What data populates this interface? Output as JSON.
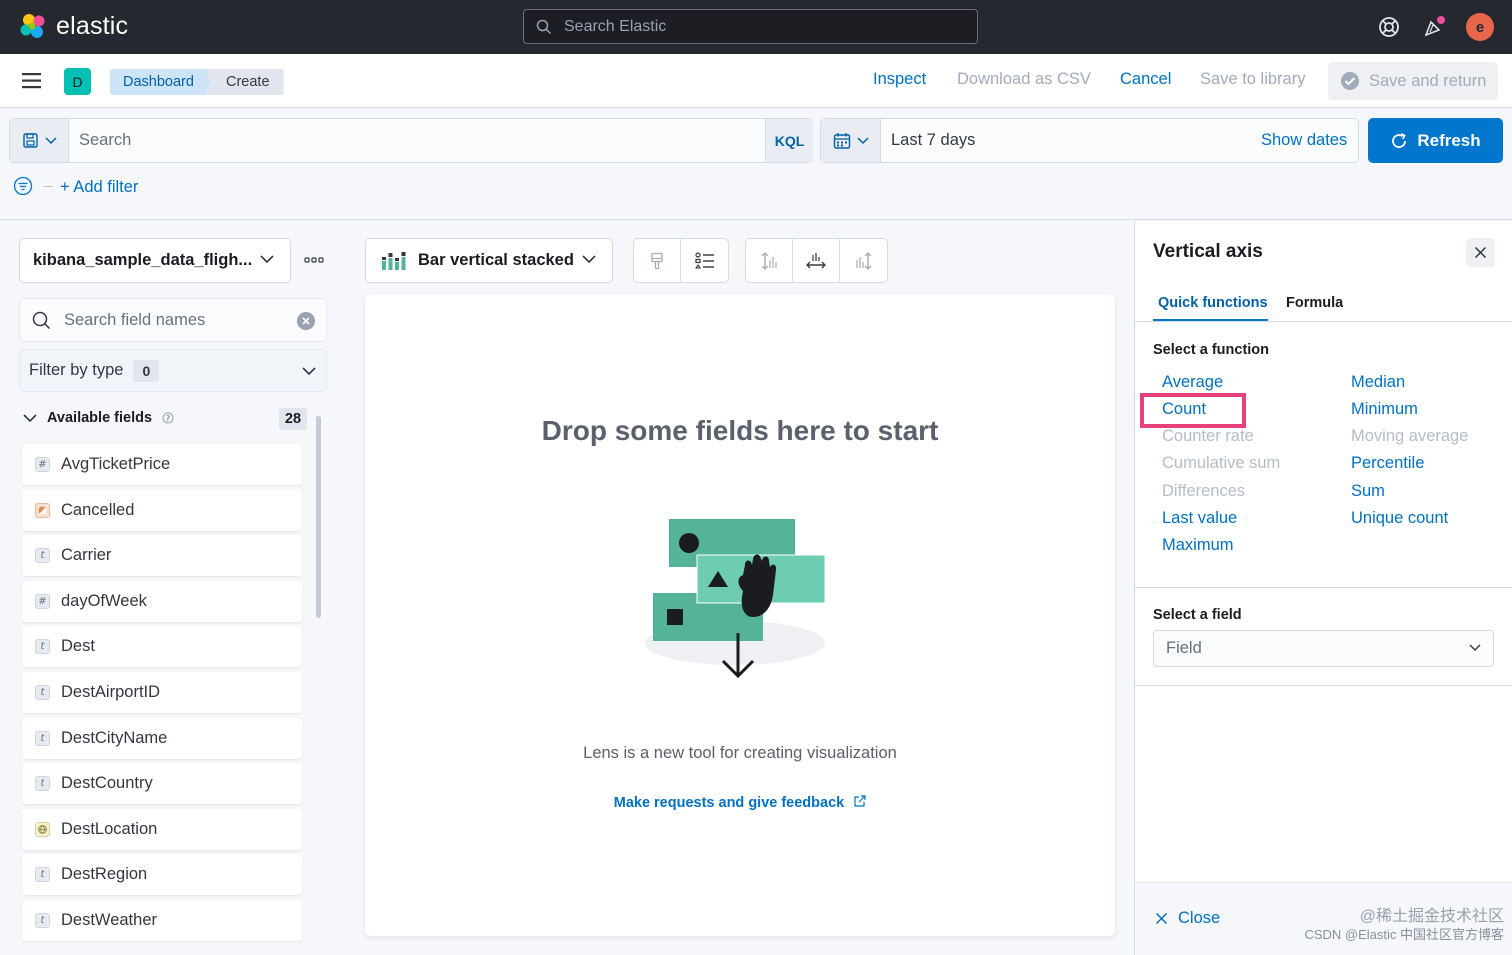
{
  "topbar": {
    "logo_text": "elastic",
    "search_placeholder": "Search Elastic",
    "user_initial": "e",
    "icons": [
      "help-icon",
      "newsfeed-icon"
    ]
  },
  "header": {
    "space_initial": "D",
    "breadcrumbs": [
      "Dashboard",
      "Create"
    ],
    "inspect": "Inspect",
    "download_csv": "Download as CSV",
    "cancel": "Cancel",
    "save_to_library": "Save to library",
    "save_and_return": "Save and return"
  },
  "query": {
    "placeholder": "Search",
    "language": "KQL",
    "date_range": "Last 7 days",
    "show_dates": "Show dates",
    "refresh": "Refresh",
    "add_filter": "+ Add filter"
  },
  "left_panel": {
    "index_pattern": "kibana_sample_data_fligh...",
    "field_search_placeholder": "Search field names",
    "filter_by_type": "Filter by type",
    "filter_count": "0",
    "available_fields_label": "Available fields",
    "available_fields_count": "28",
    "fields": [
      {
        "name": "AvgTicketPrice",
        "type": "#"
      },
      {
        "name": "Cancelled",
        "type": "bool"
      },
      {
        "name": "Carrier",
        "type": "t"
      },
      {
        "name": "dayOfWeek",
        "type": "#"
      },
      {
        "name": "Dest",
        "type": "t"
      },
      {
        "name": "DestAirportID",
        "type": "t"
      },
      {
        "name": "DestCityName",
        "type": "t"
      },
      {
        "name": "DestCountry",
        "type": "t"
      },
      {
        "name": "DestLocation",
        "type": "geo"
      },
      {
        "name": "DestRegion",
        "type": "t"
      },
      {
        "name": "DestWeather",
        "type": "t"
      }
    ]
  },
  "workspace": {
    "chart_type": "Bar vertical stacked",
    "title": "Drop some fields here to start",
    "description": "Lens is a new tool for creating visualization",
    "feedback_link": "Make requests and give feedback"
  },
  "flyout": {
    "title": "Vertical axis",
    "tabs": [
      "Quick functions",
      "Formula"
    ],
    "select_function_label": "Select a function",
    "functions_left": [
      {
        "label": "Average",
        "enabled": true
      },
      {
        "label": "Count",
        "enabled": true
      },
      {
        "label": "Counter rate",
        "enabled": false
      },
      {
        "label": "Cumulative sum",
        "enabled": false
      },
      {
        "label": "Differences",
        "enabled": false
      },
      {
        "label": "Last value",
        "enabled": true
      },
      {
        "label": "Maximum",
        "enabled": true
      }
    ],
    "functions_right": [
      {
        "label": "Median",
        "enabled": true
      },
      {
        "label": "Minimum",
        "enabled": true
      },
      {
        "label": "Moving average",
        "enabled": false
      },
      {
        "label": "Percentile",
        "enabled": true
      },
      {
        "label": "Sum",
        "enabled": true
      },
      {
        "label": "Unique count",
        "enabled": true
      }
    ],
    "select_field_label": "Select a field",
    "field_placeholder": "Field",
    "close": "Close"
  },
  "watermark": {
    "line1": "@稀土掘金技术社区",
    "line2": "CSDN @Elastic 中国社区官方博客"
  },
  "colors": {
    "accent": "#0077cc",
    "highlight": "#e8407a",
    "topbar": "#25282f"
  }
}
